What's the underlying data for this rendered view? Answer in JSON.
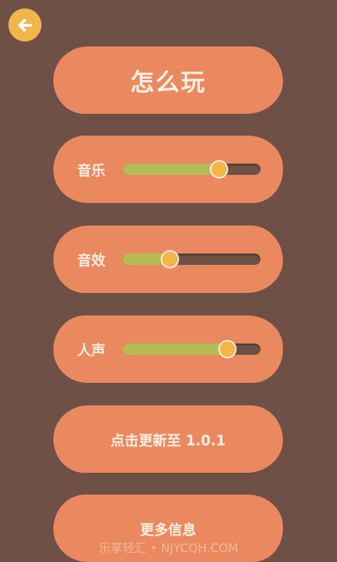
{
  "header": {
    "back_icon": "arrow-left-icon"
  },
  "title": "怎么玩",
  "sliders": [
    {
      "label": "音乐",
      "value": 0.7
    },
    {
      "label": "音效",
      "value": 0.34
    },
    {
      "label": "人声",
      "value": 0.76
    }
  ],
  "buttons": {
    "update_label": "点击更新至 1.0.1",
    "more_info_label": "更多信息"
  },
  "watermark": "乐享轻汇 • NJYCQH.COM",
  "colors": {
    "background": "#6e5047",
    "pill": "#ea895f",
    "accent_yellow": "#f2b54a",
    "slider_fill": "#b2bd57",
    "text_light": "#fbeee2"
  }
}
